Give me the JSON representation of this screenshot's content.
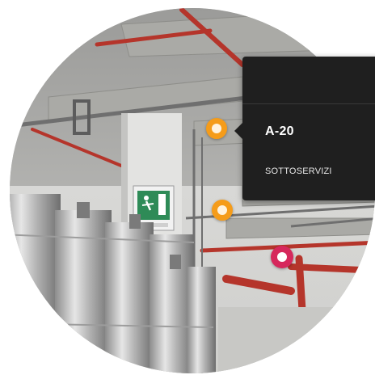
{
  "popup": {
    "title": "A-20",
    "subtitle": "SOTTOSERVIZI"
  },
  "markers": [
    {
      "name": "poi-marker-a20",
      "color": "#f59c1a",
      "selected": true
    },
    {
      "name": "poi-marker-orange",
      "color": "#f59c1a",
      "selected": false
    },
    {
      "name": "poi-marker-pink",
      "color": "#d6285c",
      "selected": false
    }
  ],
  "scene": {
    "description_icon": "emergency-exit-sign-icon",
    "colors": {
      "background": "#ffffff",
      "popup_bg": "#1f1f1f",
      "marker_orange": "#f59c1a",
      "marker_pink": "#d6285c",
      "pipe_red": "#b5352b",
      "exit_sign_green": "#2e8b57"
    }
  }
}
